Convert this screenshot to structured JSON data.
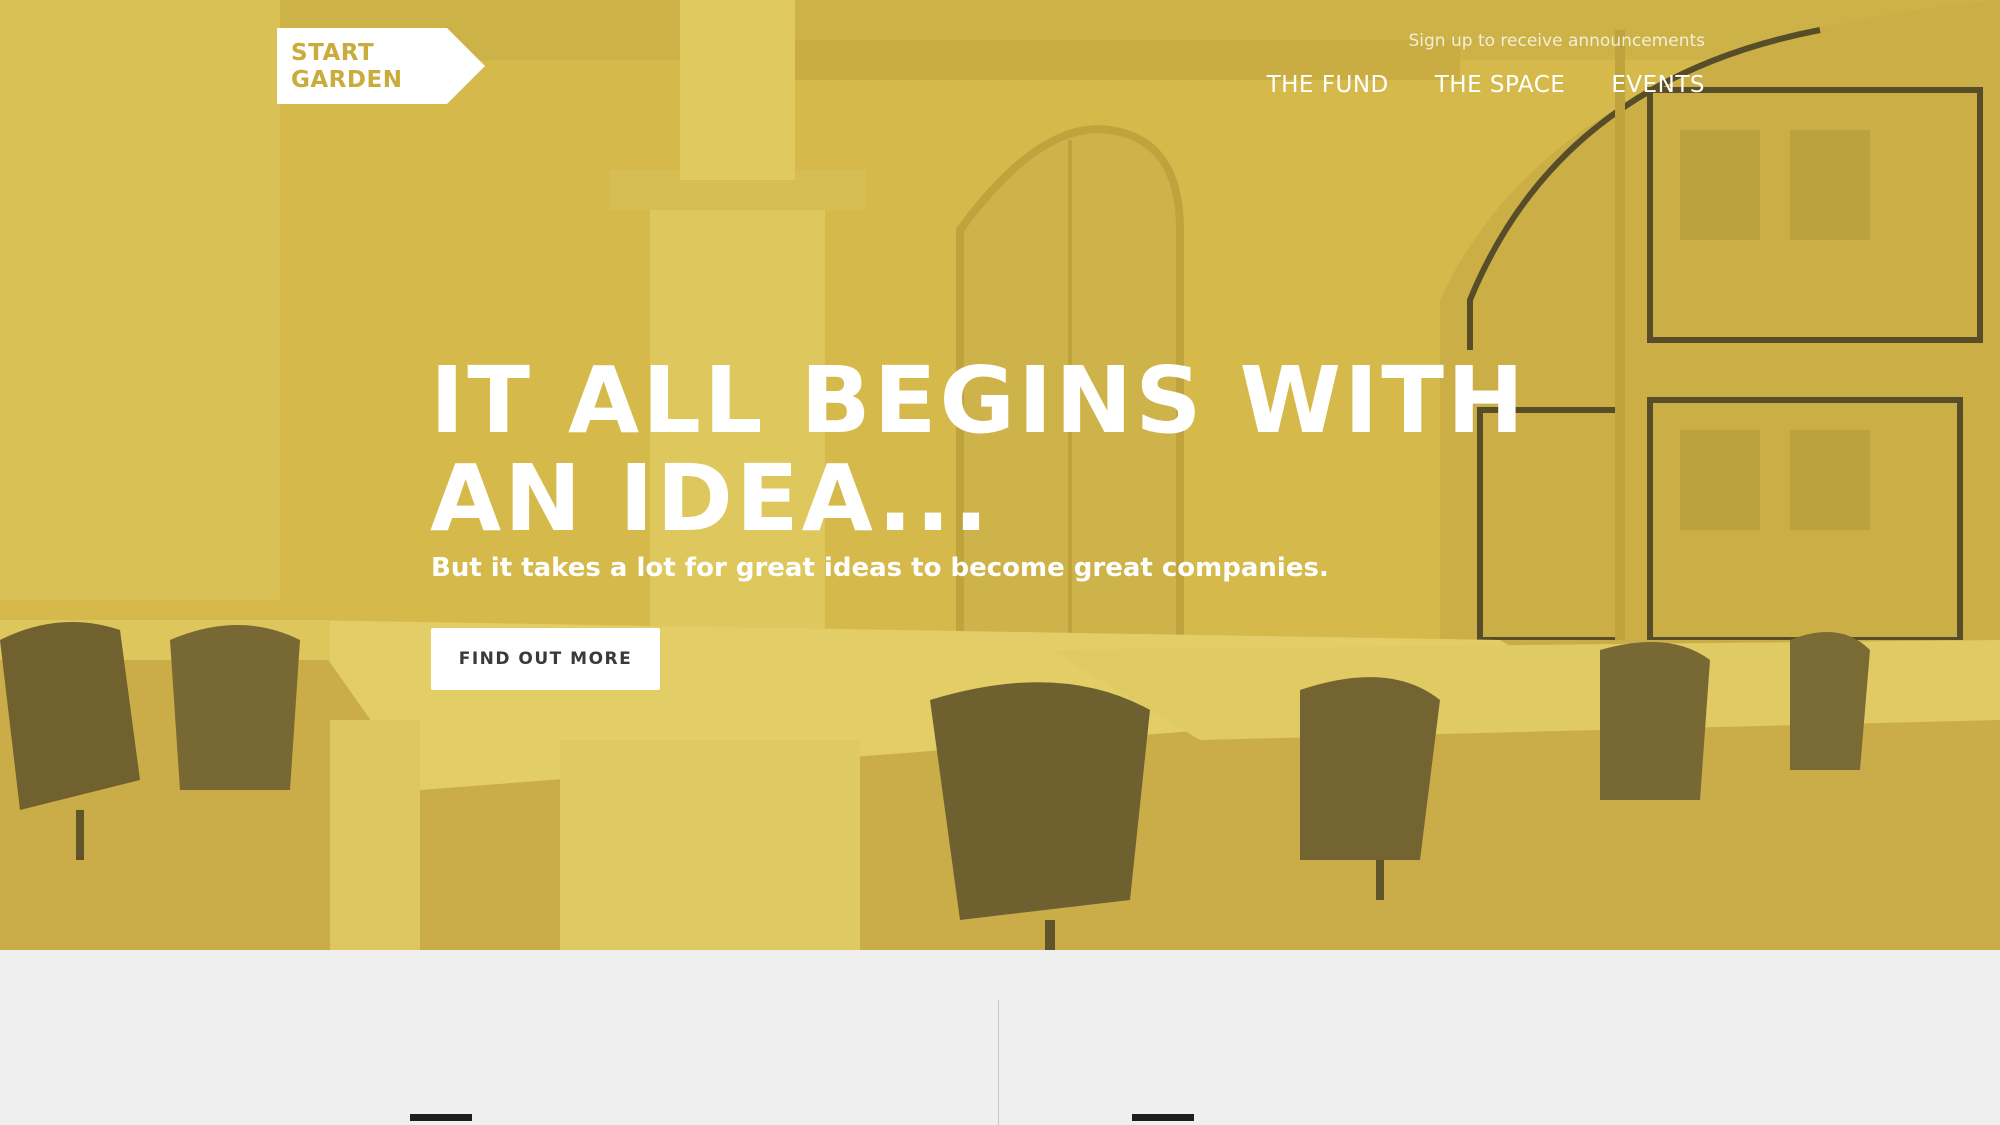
{
  "brand": {
    "logo_line1": "START",
    "logo_line2": "GARDEN",
    "accent_color": "#d2b84a"
  },
  "header": {
    "signup_link": "Sign up to receive announcements",
    "nav": [
      {
        "label": "THE FUND"
      },
      {
        "label": "THE SPACE"
      },
      {
        "label": "EVENTS"
      }
    ]
  },
  "hero": {
    "headline_line1": "IT ALL BEGINS WITH",
    "headline_line2": "AN IDEA...",
    "subheadline": "But it takes a lot for great ideas to become great companies.",
    "cta_label": "FIND OUT MORE"
  }
}
